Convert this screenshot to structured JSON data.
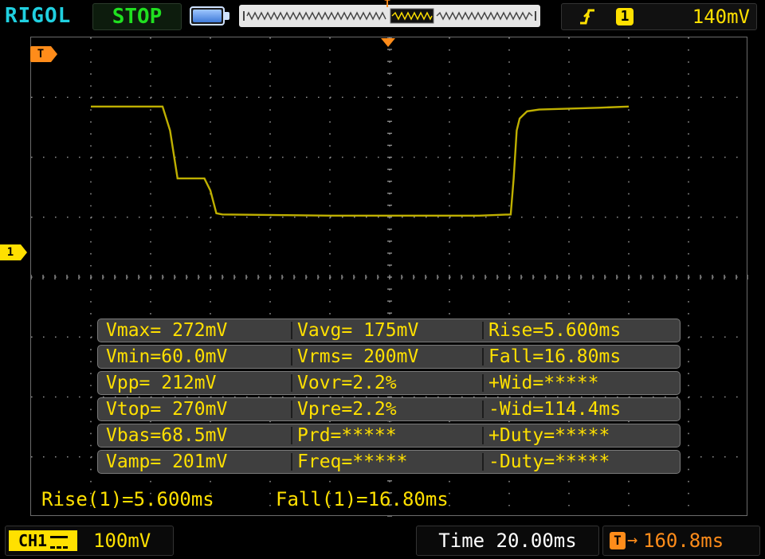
{
  "header": {
    "brand": "RIGOL",
    "run_state": "STOP",
    "trigger_marker": "T",
    "trigger_channel": "1",
    "trigger_level": "140mV"
  },
  "colors": {
    "brand": "#20d0e0",
    "run_state": "#20e020",
    "channel1": "#ffe000",
    "trigger": "#ff8c1a",
    "trace": "#bfb000",
    "grid": "#8a8a8a"
  },
  "icons": {
    "battery": "battery-icon",
    "trigger_edge": "rising-edge-icon",
    "trigger_position": "trigger-position-icon"
  },
  "markers": {
    "trigger_level_tab": "T",
    "channel1_tab": "1"
  },
  "waveform": {
    "channel": "CH1",
    "volts_per_div": 0.1,
    "time_per_div_ms": 20,
    "x_ms": [
      -80,
      -56,
      -53.5,
      -51,
      -47,
      -42,
      -40,
      -38,
      -36,
      0,
      20,
      50,
      60.5,
      61.5,
      62.5,
      63.5,
      64.5,
      66,
      70,
      90,
      100
    ],
    "y_mv": [
      270,
      270,
      230,
      150,
      150,
      150,
      130,
      92,
      90,
      88,
      88,
      88,
      90,
      150,
      230,
      250,
      255,
      262,
      265,
      268,
      270
    ]
  },
  "measurements": [
    [
      "Vmax= 272mV",
      "Vavg= 175mV",
      "Rise=5.600ms"
    ],
    [
      "Vmin=60.0mV",
      "Vrms= 200mV",
      "Fall=16.80ms"
    ],
    [
      "Vpp= 212mV",
      "Vovr=2.2%",
      "+Wid=*****"
    ],
    [
      "Vtop= 270mV",
      "Vpre=2.2%",
      "-Wid=114.4ms"
    ],
    [
      "Vbas=68.5mV",
      "Prd=*****",
      "+Duty=*****"
    ],
    [
      "Vamp= 201mV",
      "Freq=*****",
      "-Duty=*****"
    ]
  ],
  "summary": {
    "rise": "Rise(1)=5.600ms",
    "fall": "Fall(1)=16.80ms"
  },
  "footer": {
    "channel_tag": "CH1",
    "channel_scale": "100mV",
    "timebase": "Time 20.00ms",
    "trigger_offset": "160.8ms"
  }
}
